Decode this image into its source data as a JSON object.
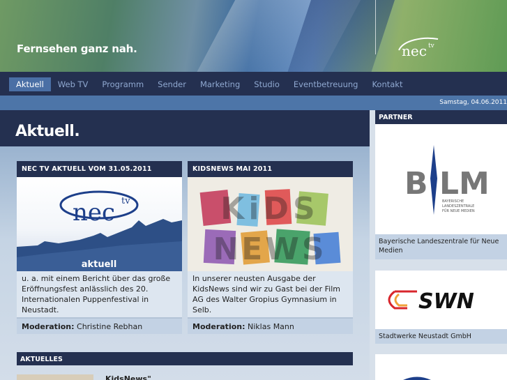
{
  "header": {
    "slogan": "Fernsehen ganz nah.",
    "logo_text": "nec",
    "logo_sup": "tv"
  },
  "nav": {
    "items": [
      {
        "label": "Aktuell",
        "active": true
      },
      {
        "label": "Web TV"
      },
      {
        "label": "Programm"
      },
      {
        "label": "Sender"
      },
      {
        "label": "Marketing"
      },
      {
        "label": "Studio"
      },
      {
        "label": "Eventbetreuung"
      },
      {
        "label": "Kontakt"
      }
    ]
  },
  "date": "Samstag, 04.06.2011",
  "page_title": "Aktuell.",
  "cards": [
    {
      "title": "NEC TV AKTUELL VOM 31.05.2011",
      "image_logo": "nec",
      "image_logo_sup": "tv",
      "image_caption": "aktuell",
      "text": "u. a. mit einem Bericht über das große Eröffnungsfest anlässlich des 20. Internationalen Puppenfestival in Neustadt.",
      "foot_label": "Moderation:",
      "foot_value": " Christine Rebhan"
    },
    {
      "title": "KIDSNEWS MAI 2011",
      "image_line1": "KiDS",
      "image_line2": "NEWS",
      "text": "In unserer neusten Ausgabe der KidsNews sind wir zu Gast bei der Film AG des Walter Gropius Gymnasium in Selb.",
      "foot_label": "Moderation:",
      "foot_value": " Niklas Mann"
    }
  ],
  "aktuelles": {
    "title": "AKTUELLES",
    "item": "KidsNews\""
  },
  "partner": {
    "title": "PARTNER",
    "items": [
      {
        "logo_b": "B",
        "logo_lm": "LM",
        "logo_sub": "BAYERISCHE\nLANDESZENTRALE\nFÜR NEUE MEDIEN",
        "caption": "Bayerische Landeszentrale für Neue Medien"
      },
      {
        "logo": "SWN",
        "caption": "Stadtwerke Neustadt GmbH"
      }
    ]
  },
  "colors": {
    "nav_bg": "#243050",
    "accent": "#4a6fa5",
    "swn_red": "#d8262c"
  }
}
